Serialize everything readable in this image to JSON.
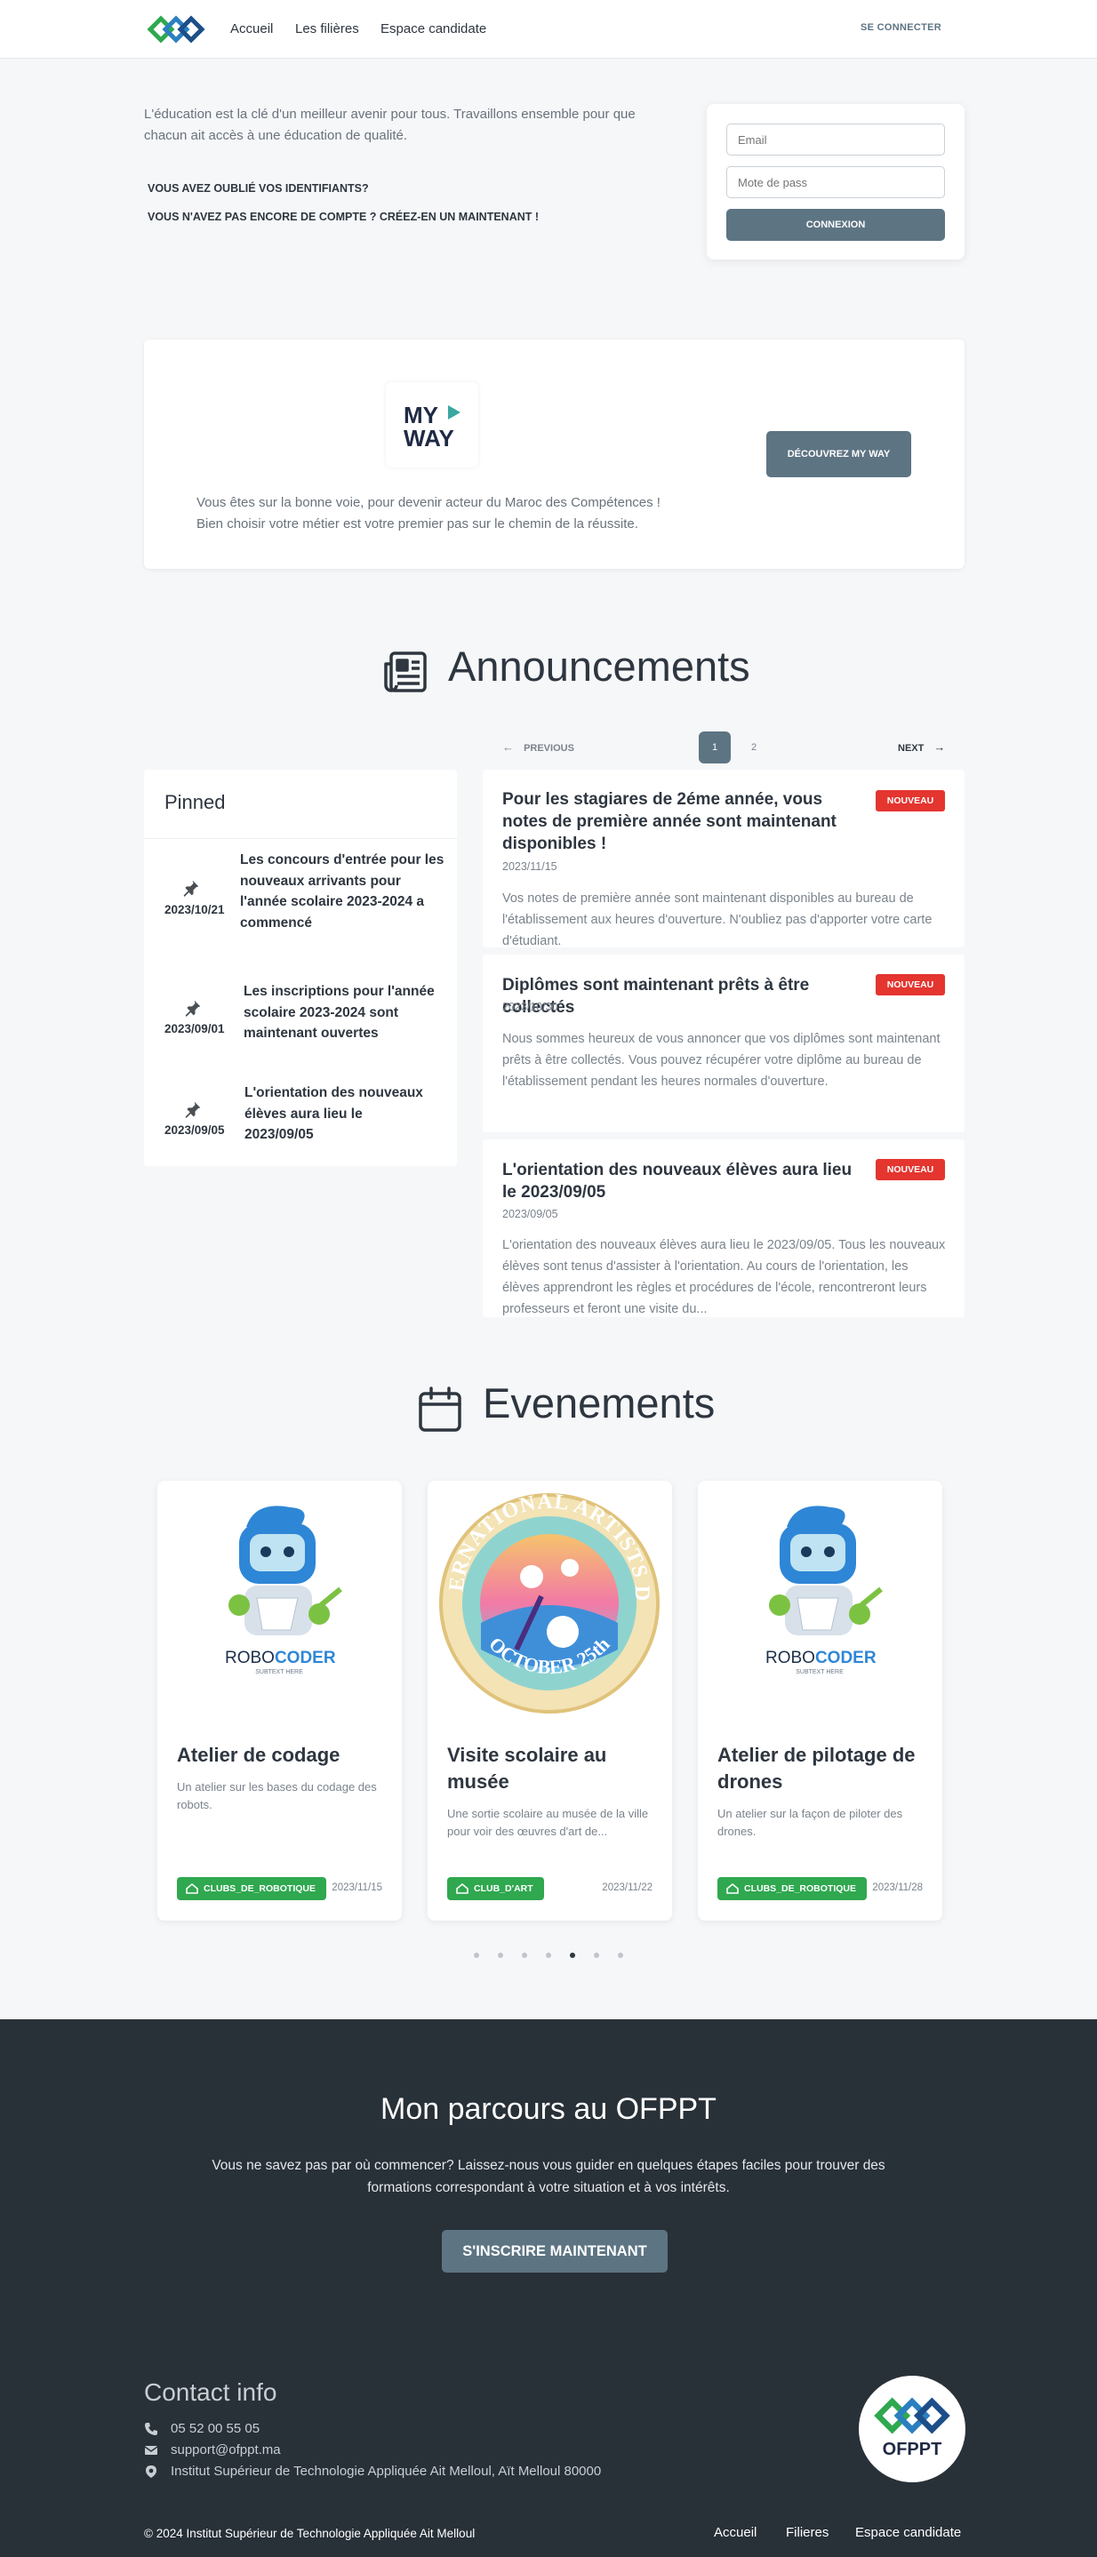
{
  "nav": {
    "links": [
      "Accueil",
      "Les filières",
      "Espace candidate"
    ],
    "signin": "SE CONNECTER"
  },
  "login": {
    "intro": "L'éducation est la clé d'un meilleur avenir pour tous. Travaillons ensemble pour que chacun ait accès à une éducation de qualité.",
    "forgot": "VOUS AVEZ OUBLIÉ VOS IDENTIFIANTS?",
    "no_account": "VOUS N'AVEZ PAS ENCORE DE COMPTE ? CRÉEZ-EN UN MAINTENANT !",
    "email_placeholder": "Email",
    "password_placeholder": "Mote de pass",
    "submit": "CONNEXION"
  },
  "myway": {
    "logo_line1": "MY",
    "logo_line2": "WAY",
    "button": "DÉCOUVREZ MY WAY",
    "line1": "Vous êtes sur la bonne voie, pour devenir acteur du Maroc des Compétences !",
    "line2": "Bien choisir votre métier est votre premier pas sur le chemin de la réussite."
  },
  "announcements": {
    "title": "Announcements",
    "previous": "PREVIOUS",
    "next": "NEXT",
    "pages": [
      "1",
      "2"
    ],
    "pinned_title": "Pinned",
    "pinned": [
      {
        "date": "2023/10/21",
        "text": "Les concours d'entrée pour les nouveaux arrivants pour l'année scolaire 2023-2024 a commencé"
      },
      {
        "date": "2023/09/01",
        "text": "Les inscriptions pour l'année scolaire 2023-2024 sont maintenant ouvertes"
      },
      {
        "date": "2023/09/05",
        "text": "L'orientation des nouveaux élèves aura lieu le 2023/09/05"
      }
    ],
    "items": [
      {
        "title": "Pour les stagiares de 2éme année, vous notes de première année sont maintenant disponibles !",
        "badge": "NOUVEAU",
        "date": "2023/11/15",
        "body": "Vos notes de première année sont maintenant disponibles au bureau de l'établissement aux heures d'ouverture. N'oubliez pas d'apporter votre carte d'étudiant."
      },
      {
        "title": "Diplômes sont maintenant prêts à être collectés",
        "badge": "NOUVEAU",
        "date": "2023/10/30",
        "body": "Nous sommes heureux de vous annoncer que vos diplômes sont maintenant prêts à être collectés. Vous pouvez récupérer votre diplôme au bureau de l'établissement pendant les heures normales d'ouverture."
      },
      {
        "title": "L'orientation des nouveaux élèves aura lieu le 2023/09/05",
        "badge": "NOUVEAU",
        "date": "2023/09/05",
        "body": "L'orientation des nouveaux élèves aura lieu le 2023/09/05. Tous les nouveaux élèves sont tenus d'assister à l'orientation. Au cours de l'orientation, les élèves apprendront les règles et procédures de l'école, rencontreront leurs professeurs et feront une visite du..."
      }
    ]
  },
  "events": {
    "title": "Evenements",
    "items": [
      {
        "title": "Atelier de codage",
        "desc": "Un atelier sur les bases du codage des robots.",
        "tag": "CLUBS_DE_ROBOTIQUE",
        "date": "2023/11/15",
        "img_brand_a": "ROBO",
        "img_brand_b": "CODER",
        "img_sub": "SUBTEXT HERE"
      },
      {
        "title": "Visite scolaire au musée",
        "desc": "Une sortie scolaire au musée de la ville pour voir des œuvres d'art de...",
        "tag": "CLUB_D'ART",
        "date": "2023/11/22",
        "img_top": "INTERNATIONAL ARTISTS DAY",
        "img_bottom": "OCTOBER 25th"
      },
      {
        "title": "Atelier de pilotage de drones",
        "desc": "Un atelier sur la façon de piloter des drones.",
        "tag": "CLUBS_DE_ROBOTIQUE",
        "date": "2023/11/28",
        "img_brand_a": "ROBO",
        "img_brand_b": "CODER",
        "img_sub": "SUBTEXT HERE"
      }
    ],
    "carousel_dots": 7,
    "active_dot": 5
  },
  "parcours": {
    "title": "Mon parcours au OFPPT",
    "text": "Vous ne savez pas par où commencer? Laissez-nous vous guider en quelques étapes faciles pour trouver des formations correspondant à votre situation et à vos intérêts.",
    "button": "S'INSCRIRE MAINTENANT"
  },
  "contact": {
    "title": "Contact info",
    "phone": "05 52 00 55 05",
    "email": "support@ofppt.ma",
    "address": "Institut Supérieur de Technologie Appliquée Ait Melloul, Aït Melloul 80000"
  },
  "footer": {
    "brand": "OFPPT",
    "copyright": "© 2024 Institut Supérieur de Technologie Appliquée Ait Melloul",
    "links": [
      "Accueil",
      "Filieres",
      "Espace candidate"
    ]
  },
  "colors": {
    "accent": "#5d7483",
    "badge": "#e4352f",
    "tag": "#2fa84f",
    "dark": "#283038"
  }
}
